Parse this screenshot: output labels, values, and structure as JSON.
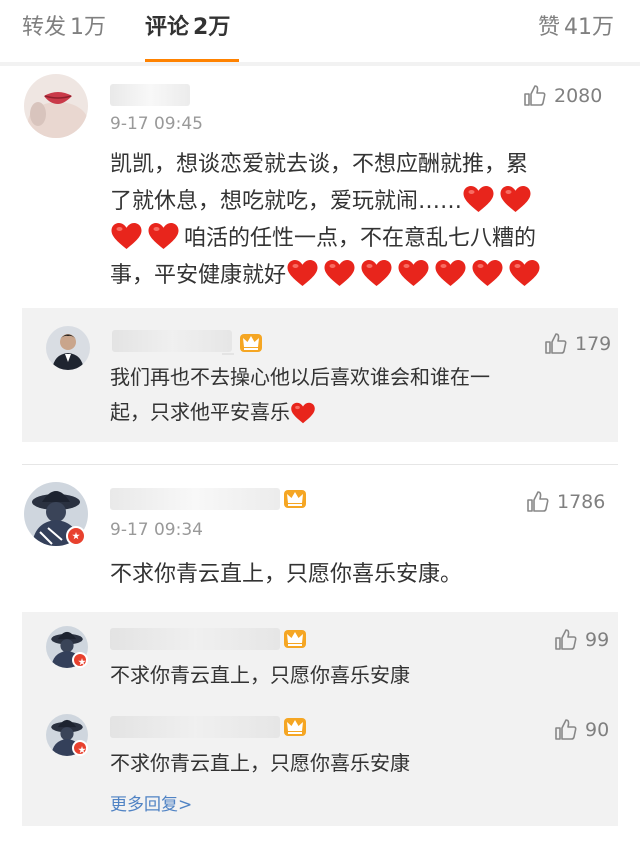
{
  "tabs": {
    "repost": {
      "label": "转发",
      "count": "1万"
    },
    "comment": {
      "label": "评论",
      "count": "2万"
    },
    "like": {
      "label": "赞",
      "count": "41万"
    }
  },
  "colors": {
    "accent": "#ff8200",
    "heart": "#e8251c",
    "link": "#5083c4",
    "crown": "#f5a623"
  },
  "comments": [
    {
      "time": "9-17 09:45",
      "likes": "2080",
      "text_segments": [
        "凯凯，想谈恋爱就去谈，不想应酬就推，累",
        "了就休息，想吃就吃，爱玩就闹……",
        "咱活的任性一点，不在意乱七八糟的",
        "事，平安健康就好"
      ],
      "replies": [
        {
          "likes": "179",
          "text_lines": [
            "我们再也不去操心他以后喜欢谁会和谁在一",
            "起，只求他平安喜乐"
          ]
        }
      ]
    },
    {
      "time": "9-17 09:34",
      "likes": "1786",
      "text": "不求你青云直上，只愿你喜乐安康。",
      "replies": [
        {
          "likes": "99",
          "text": "不求你青云直上，只愿你喜乐安康"
        },
        {
          "likes": "90",
          "text": "不求你青云直上，只愿你喜乐安康"
        }
      ],
      "more_replies_label": "更多回复>"
    }
  ]
}
